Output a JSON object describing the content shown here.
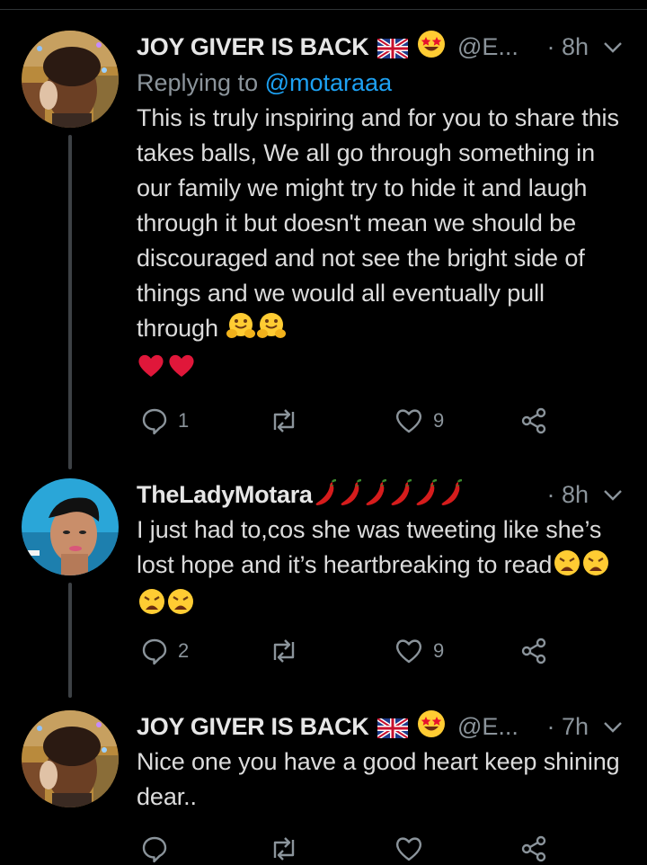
{
  "tweets": [
    {
      "name": "JOY GIVER IS BACK",
      "handle": "@E...",
      "time": "· 8h",
      "replying_prefix": "Replying to",
      "replying_to": "@motaraaa",
      "text": "This is truly inspiring and for you to share this takes balls, We all go through something in our family we might try to hide it and laugh through it but doesn't mean we should be discouraged and not see the bright side of things and we would all eventually pull through",
      "name_emojis": [
        "uk-flag-icon",
        "star-struck-icon"
      ],
      "text_emojis": [
        "hugging-face-icon",
        "hugging-face-icon",
        "red-heart-icon",
        "red-heart-icon"
      ],
      "stats": {
        "replies": "1",
        "retweets": "",
        "likes": "9"
      }
    },
    {
      "name": "TheLadyMotara",
      "handle": "",
      "time": "· 8h",
      "text": "I just had to,cos she was tweeting like she’s lost hope and it’s heartbreaking to read",
      "name_emojis": [
        "chili-pepper-icon",
        "chili-pepper-icon",
        "chili-pepper-icon",
        "chili-pepper-icon",
        "chili-pepper-icon",
        "chili-pepper-icon"
      ],
      "text_emojis": [
        "weary-face-icon",
        "weary-face-icon",
        "weary-face-icon",
        "weary-face-icon"
      ],
      "stats": {
        "replies": "2",
        "retweets": "",
        "likes": "9"
      }
    },
    {
      "name": "JOY GIVER IS BACK",
      "handle": "@E...",
      "time": "· 7h",
      "text": "Nice one you have a good heart keep shining dear..",
      "name_emojis": [
        "uk-flag-icon",
        "star-struck-icon"
      ],
      "text_emojis": [],
      "stats": {
        "replies": "",
        "retweets": "",
        "likes": ""
      }
    }
  ],
  "colors": {
    "background": "#000000",
    "text": "#d9d9d9",
    "muted": "#8b949b",
    "link": "#1da1f2",
    "thread_line": "#3d4145"
  }
}
